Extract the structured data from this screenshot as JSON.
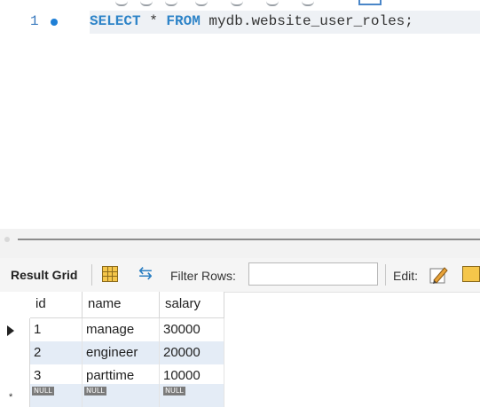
{
  "editor": {
    "line_number": "1",
    "kw_select": "SELECT",
    "star": " * ",
    "kw_from": "FROM",
    "table": " mydb.website_user_roles;"
  },
  "toolbar": {
    "result_grid_label": "Result Grid",
    "filter_label": "Filter Rows:",
    "filter_value": "",
    "edit_label": "Edit:"
  },
  "grid": {
    "columns": [
      "id",
      "name",
      "salary"
    ],
    "rows": [
      {
        "id": "1",
        "name": "manage",
        "salary": "30000"
      },
      {
        "id": "2",
        "name": "engineer",
        "salary": "20000"
      },
      {
        "id": "3",
        "name": "parttime",
        "salary": "10000"
      }
    ],
    "null_label": "NULL",
    "new_row_marker": "*"
  },
  "colors": {
    "keyword": "#2e84c8",
    "line_number": "#3b7bbf",
    "alt_row": "#e4ecf6"
  }
}
